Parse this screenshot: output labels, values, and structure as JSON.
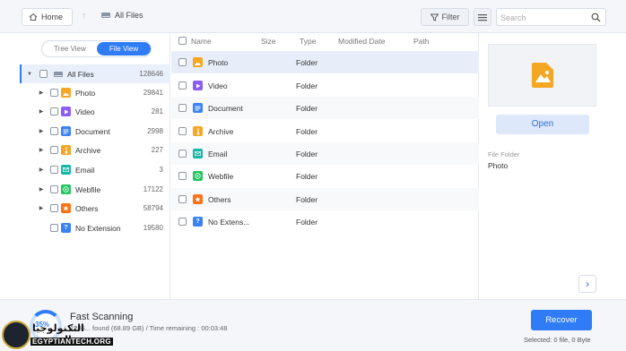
{
  "toolbar": {
    "home_label": "Home",
    "breadcrumb": "All Files",
    "filter_label": "Filter",
    "search_placeholder": "Search",
    "icons": [
      "home-icon",
      "up-arrow-icon",
      "drive-icon",
      "filter-icon",
      "list-view-icon",
      "search-icon"
    ]
  },
  "view_toggle": {
    "tree": "Tree View",
    "file": "File View",
    "active": "File View"
  },
  "tree": {
    "root": {
      "label": "All Files",
      "count": "128646"
    },
    "items": [
      {
        "label": "Photo",
        "count": "29841",
        "icon": "photo-icon",
        "color": "#f5a623"
      },
      {
        "label": "Video",
        "count": "281",
        "icon": "video-icon",
        "color": "#8b5cf6"
      },
      {
        "label": "Document",
        "count": "2998",
        "icon": "document-icon",
        "color": "#3b82f6"
      },
      {
        "label": "Archive",
        "count": "227",
        "icon": "archive-icon",
        "color": "#f5a623"
      },
      {
        "label": "Email",
        "count": "3",
        "icon": "email-icon",
        "color": "#14b8a6"
      },
      {
        "label": "Webfile",
        "count": "17122",
        "icon": "webfile-icon",
        "color": "#22c55e"
      },
      {
        "label": "Others",
        "count": "58794",
        "icon": "others-icon",
        "color": "#f97316"
      },
      {
        "label": "No Extension",
        "count": "19580",
        "icon": "no-extension-icon",
        "color": "#3b82f6"
      }
    ]
  },
  "list": {
    "columns": [
      "Name",
      "Size",
      "Type",
      "Modified Date",
      "Path"
    ],
    "rows": [
      {
        "name": "Photo",
        "type": "Folder"
      },
      {
        "name": "Video",
        "type": "Folder"
      },
      {
        "name": "Document",
        "type": "Folder"
      },
      {
        "name": "Archive",
        "type": "Folder"
      },
      {
        "name": "Email",
        "type": "Folder"
      },
      {
        "name": "Webfile",
        "type": "Folder"
      },
      {
        "name": "Others",
        "type": "Folder"
      },
      {
        "name": "No Extens...",
        "type": "Folder"
      }
    ]
  },
  "details": {
    "open_label": "Open",
    "info_label": "File Folder",
    "info_value": "Photo"
  },
  "status": {
    "progress_percent": "35%",
    "progress_fraction": 0.35,
    "title": "Fast Scanning",
    "detail": "1285... found (68.89 GB) / Time remaining : 00:03:48",
    "recover_label": "Recover",
    "selected": "Selected: 0 file, 0 Byte"
  },
  "watermark": {
    "arabic": "التكنولوجيا المصرية",
    "english": "EGYPTIANTECH.ORG"
  },
  "colors": {
    "accent": "#2f7cf6",
    "toolbar_bg": "#f4f6fa",
    "selected_row": "#e8eef9"
  }
}
